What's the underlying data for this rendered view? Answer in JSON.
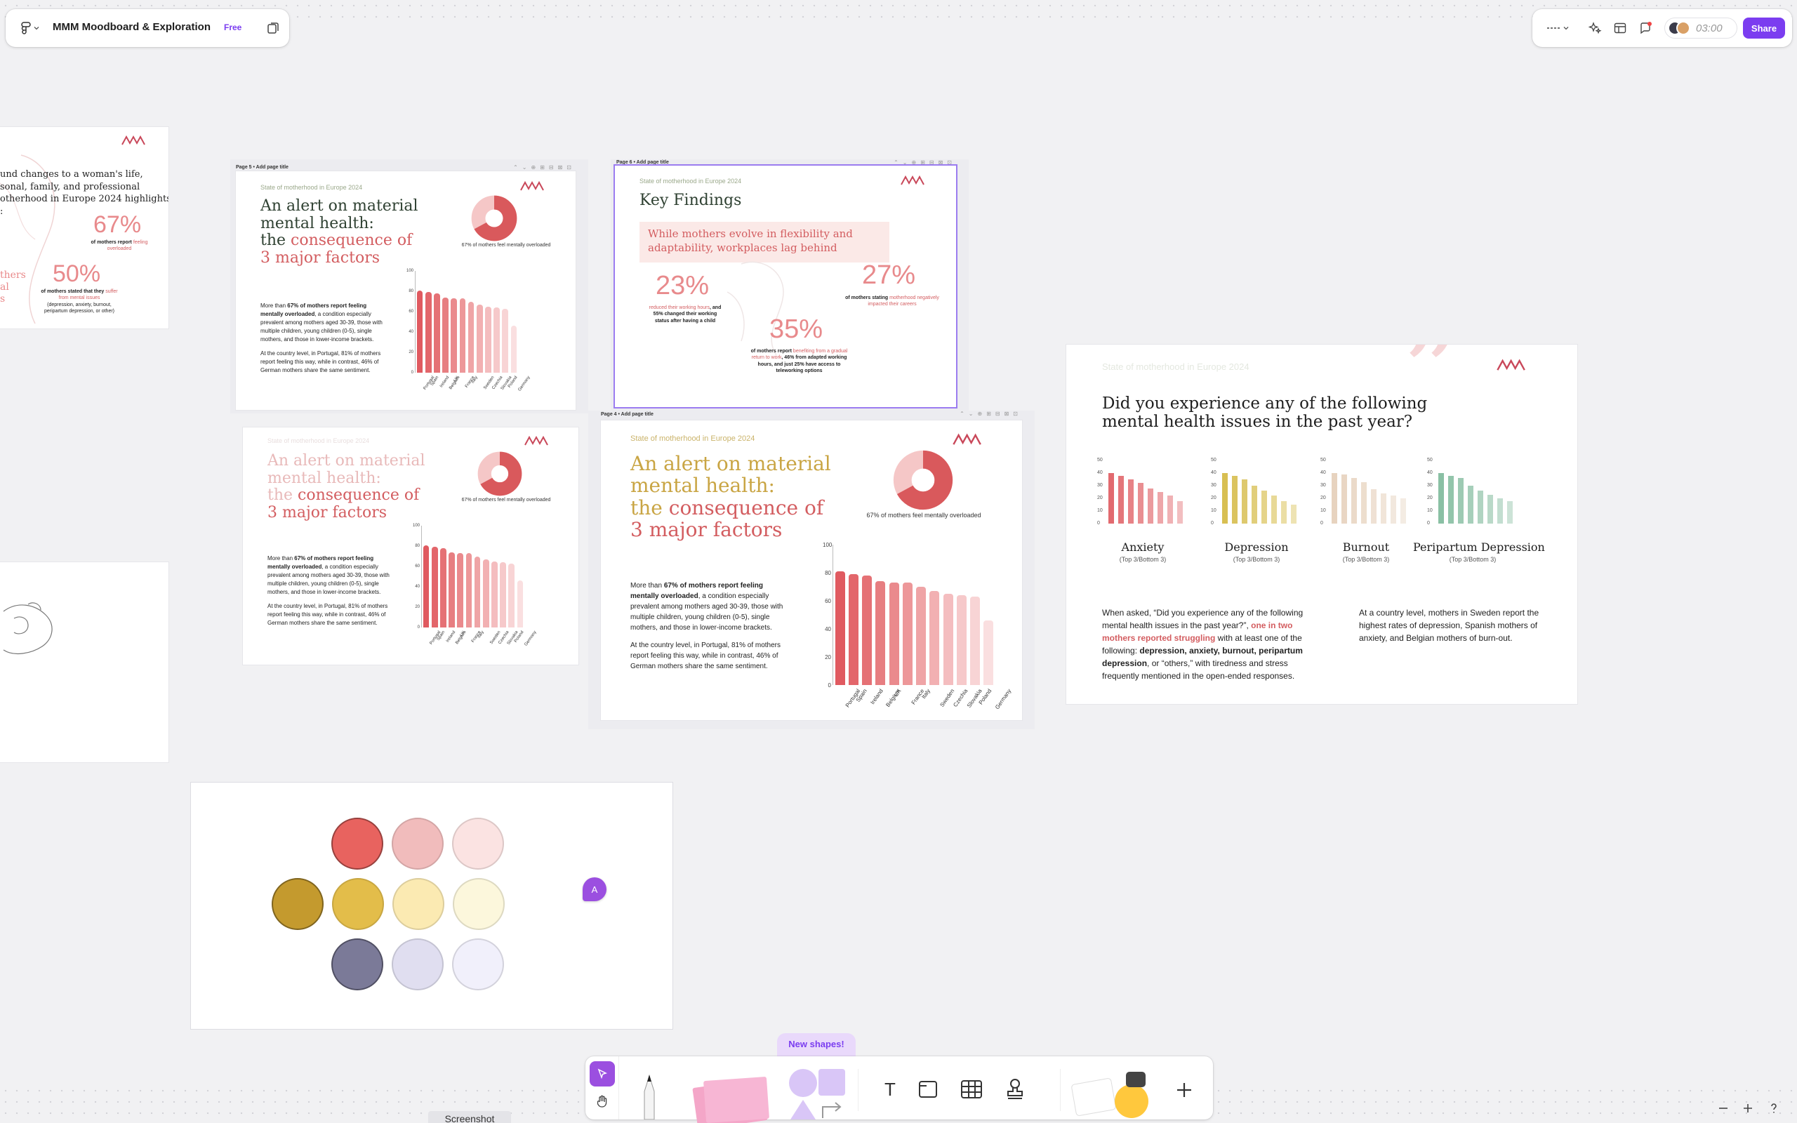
{
  "app": {
    "file_name": "MMM Moodboard & Exploration",
    "plan_badge": "Free",
    "timer": "03:00",
    "share_label": "Share",
    "cursor_avatar": "A"
  },
  "toolbar": {
    "new_shapes_label": "New shapes!",
    "screenshot_tooltip": "Screenshot",
    "text_tool_glyph": "T"
  },
  "colors": {
    "accent": "#7b3df0",
    "pink": "#e5626a",
    "gold": "#c9a544"
  },
  "slide_common": {
    "subtitle": "State of motherhood in Europe 2024",
    "page5_title": "Page 5 • Add page title",
    "page6_title": "Page 6 • Add page title",
    "page4_title": "Page 4 • Add page title",
    "alert_h1": "An alert on material",
    "alert_h2": "mental health:",
    "alert_h3a": "the ",
    "alert_h3b": "consequence of",
    "alert_h4": "3 major factors",
    "donut_caption": "67% of mothers feel mentally overloaded",
    "para1_a": "More than ",
    "para1_b": "67% of mothers report feeling mentally overloaded",
    "para1_c": ", a condition especially prevalent among mothers aged 30-39, those with multiple children, young children (0-5), single mothers, and those in lower-income brackets.",
    "para2": "At the country level, in Portugal, 81% of mothers report feeling this way, while in contrast, 46% of German mothers share the same sentiment."
  },
  "bar_chart": {
    "categories": [
      "Portugal",
      "Spain",
      "Ireland",
      "Belgium",
      "UK",
      "France",
      "Italy",
      "Sweden",
      "Czechia",
      "Slovakia",
      "Poland",
      "Germany"
    ],
    "values": [
      81,
      79,
      78,
      74,
      73,
      73,
      70,
      67,
      65,
      64,
      63,
      46
    ],
    "yticks_small": [
      "100",
      "80",
      "60",
      "40",
      "20",
      "0"
    ],
    "yticks": [
      "100",
      "80",
      "60",
      "40",
      "20",
      "0"
    ]
  },
  "chart_data": [
    {
      "type": "bar",
      "title": "",
      "categories": [
        "Portugal",
        "Spain",
        "Ireland",
        "Belgium",
        "UK",
        "France",
        "Italy",
        "Sweden",
        "Czechia",
        "Slovakia",
        "Poland",
        "Germany"
      ],
      "values": [
        81,
        79,
        78,
        74,
        73,
        73,
        70,
        67,
        65,
        64,
        63,
        46
      ],
      "ylim": [
        0,
        100
      ]
    },
    {
      "type": "pie",
      "title": "67% of mothers feel mentally overloaded",
      "categories": [
        "feel mentally overloaded",
        "other"
      ],
      "values": [
        67,
        33
      ]
    },
    {
      "type": "bar",
      "title": "Anxiety",
      "values": [
        40,
        38,
        35,
        32,
        28,
        25,
        22,
        18
      ]
    },
    {
      "type": "bar",
      "title": "Depression",
      "values": [
        40,
        38,
        35,
        30,
        26,
        22,
        18,
        15
      ]
    },
    {
      "type": "bar",
      "title": "Burnout",
      "values": [
        40,
        39,
        36,
        33,
        27,
        24,
        22,
        20
      ]
    },
    {
      "type": "bar",
      "title": "Peripartum Depression",
      "values": [
        40,
        38,
        36,
        30,
        26,
        23,
        20,
        18
      ]
    }
  ],
  "left_slide": {
    "l1": "und changes to a woman's life,",
    "l2": "sonal, family, and professional",
    "l3": "otherhood in Europe 2024 highlights",
    "l4": ":",
    "stat1": "67%",
    "stat1_a": "of mothers report ",
    "stat1_b": "feeling overloaded",
    "stat2": "50%",
    "stat2_a": "of mothers stated that they ",
    "stat2_b": "suffer from mental issues",
    "stat2_c": "(depression, anxiety, burnout, peripartum depression, or other)",
    "side_l1": "thers",
    "side_l2": "al",
    "side_l3": "s"
  },
  "key_findings": {
    "title": "Key Findings",
    "banner1": "While mothers evolve in flexibility and",
    "banner2": "adaptability, workplaces lag behind",
    "s1": "23%",
    "s1_a": "reduced their working hours",
    "s1_b": ", and 55% changed their working status after having a child",
    "s2": "27%",
    "s2_a": "of mothers stating ",
    "s2_b": "motherhood negatively impacted their careers",
    "s3": "35%",
    "s3_a": "of mothers report ",
    "s3_b": "benefiting from a gradual return to work",
    "s3_c": ", 46% from adapted working hours, and just 25% have access to teleworking options"
  },
  "health": {
    "q1": "Did you experience any of the following",
    "q2": "mental health issues in the past year?",
    "quote_mark": "”",
    "mini_yticks": [
      "50",
      "40",
      "30",
      "20",
      "10",
      "0"
    ],
    "groups": [
      {
        "title": "Anxiety",
        "caption": "(Top 3/Bottom 3)",
        "color": "#e26a6f"
      },
      {
        "title": "Depression",
        "caption": "(Top 3/Bottom 3)",
        "color": "#d8bf52"
      },
      {
        "title": "Burnout",
        "caption": "(Top 3/Bottom 3)",
        "color": "#e7d3bf"
      },
      {
        "title": "Peripartum Depression",
        "caption": "(Top 3/Bottom 3)",
        "color": "#8ac0a4"
      }
    ],
    "left_a": "When asked, “Did you experience any of the following mental health issues in the past year?”, ",
    "left_b": "one in two mothers reported struggling",
    "left_c": " with at least one of the following: ",
    "left_d": "depression, anxiety, burnout, peripartum depression",
    "left_e": ", or “others,” with tiredness and stress frequently mentioned in the open-ended responses.",
    "right": "At a country level, mothers in Sweden report the highest rates of depression, Spanish mothers of anxiety, and Belgian mothers of burn-out."
  },
  "palette": [
    [
      "#e8635f",
      "#f1bcbc",
      "#fbe3e2"
    ],
    [
      "#c49a2e",
      "#e3bd4a",
      "#fbeab2",
      "#fcf7dc"
    ],
    [
      "#7b7a98",
      "#e0def0",
      "#f1f0fb"
    ]
  ]
}
